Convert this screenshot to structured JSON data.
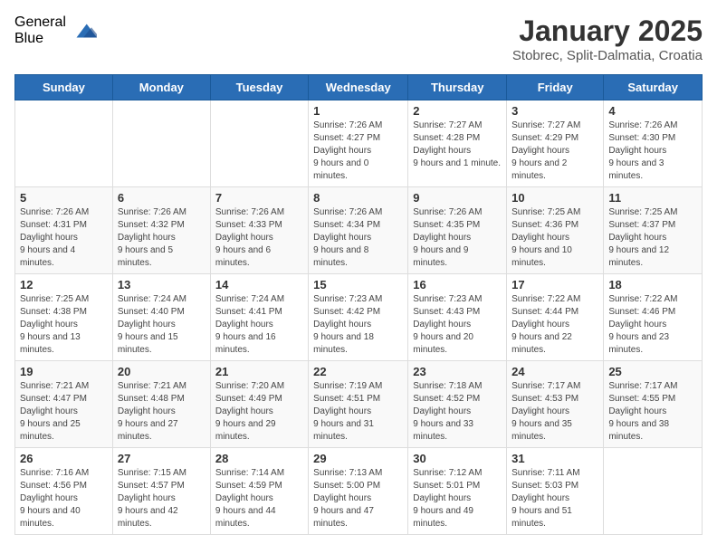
{
  "logo": {
    "general": "General",
    "blue": "Blue"
  },
  "header": {
    "title": "January 2025",
    "subtitle": "Stobrec, Split-Dalmatia, Croatia"
  },
  "weekdays": [
    "Sunday",
    "Monday",
    "Tuesday",
    "Wednesday",
    "Thursday",
    "Friday",
    "Saturday"
  ],
  "weeks": [
    [
      {
        "day": null
      },
      {
        "day": null
      },
      {
        "day": null
      },
      {
        "day": "1",
        "sunrise": "7:26 AM",
        "sunset": "4:27 PM",
        "daylight": "9 hours and 0 minutes."
      },
      {
        "day": "2",
        "sunrise": "7:27 AM",
        "sunset": "4:28 PM",
        "daylight": "9 hours and 1 minute."
      },
      {
        "day": "3",
        "sunrise": "7:27 AM",
        "sunset": "4:29 PM",
        "daylight": "9 hours and 2 minutes."
      },
      {
        "day": "4",
        "sunrise": "7:26 AM",
        "sunset": "4:30 PM",
        "daylight": "9 hours and 3 minutes."
      }
    ],
    [
      {
        "day": "5",
        "sunrise": "7:26 AM",
        "sunset": "4:31 PM",
        "daylight": "9 hours and 4 minutes."
      },
      {
        "day": "6",
        "sunrise": "7:26 AM",
        "sunset": "4:32 PM",
        "daylight": "9 hours and 5 minutes."
      },
      {
        "day": "7",
        "sunrise": "7:26 AM",
        "sunset": "4:33 PM",
        "daylight": "9 hours and 6 minutes."
      },
      {
        "day": "8",
        "sunrise": "7:26 AM",
        "sunset": "4:34 PM",
        "daylight": "9 hours and 8 minutes."
      },
      {
        "day": "9",
        "sunrise": "7:26 AM",
        "sunset": "4:35 PM",
        "daylight": "9 hours and 9 minutes."
      },
      {
        "day": "10",
        "sunrise": "7:25 AM",
        "sunset": "4:36 PM",
        "daylight": "9 hours and 10 minutes."
      },
      {
        "day": "11",
        "sunrise": "7:25 AM",
        "sunset": "4:37 PM",
        "daylight": "9 hours and 12 minutes."
      }
    ],
    [
      {
        "day": "12",
        "sunrise": "7:25 AM",
        "sunset": "4:38 PM",
        "daylight": "9 hours and 13 minutes."
      },
      {
        "day": "13",
        "sunrise": "7:24 AM",
        "sunset": "4:40 PM",
        "daylight": "9 hours and 15 minutes."
      },
      {
        "day": "14",
        "sunrise": "7:24 AM",
        "sunset": "4:41 PM",
        "daylight": "9 hours and 16 minutes."
      },
      {
        "day": "15",
        "sunrise": "7:23 AM",
        "sunset": "4:42 PM",
        "daylight": "9 hours and 18 minutes."
      },
      {
        "day": "16",
        "sunrise": "7:23 AM",
        "sunset": "4:43 PM",
        "daylight": "9 hours and 20 minutes."
      },
      {
        "day": "17",
        "sunrise": "7:22 AM",
        "sunset": "4:44 PM",
        "daylight": "9 hours and 22 minutes."
      },
      {
        "day": "18",
        "sunrise": "7:22 AM",
        "sunset": "4:46 PM",
        "daylight": "9 hours and 23 minutes."
      }
    ],
    [
      {
        "day": "19",
        "sunrise": "7:21 AM",
        "sunset": "4:47 PM",
        "daylight": "9 hours and 25 minutes."
      },
      {
        "day": "20",
        "sunrise": "7:21 AM",
        "sunset": "4:48 PM",
        "daylight": "9 hours and 27 minutes."
      },
      {
        "day": "21",
        "sunrise": "7:20 AM",
        "sunset": "4:49 PM",
        "daylight": "9 hours and 29 minutes."
      },
      {
        "day": "22",
        "sunrise": "7:19 AM",
        "sunset": "4:51 PM",
        "daylight": "9 hours and 31 minutes."
      },
      {
        "day": "23",
        "sunrise": "7:18 AM",
        "sunset": "4:52 PM",
        "daylight": "9 hours and 33 minutes."
      },
      {
        "day": "24",
        "sunrise": "7:17 AM",
        "sunset": "4:53 PM",
        "daylight": "9 hours and 35 minutes."
      },
      {
        "day": "25",
        "sunrise": "7:17 AM",
        "sunset": "4:55 PM",
        "daylight": "9 hours and 38 minutes."
      }
    ],
    [
      {
        "day": "26",
        "sunrise": "7:16 AM",
        "sunset": "4:56 PM",
        "daylight": "9 hours and 40 minutes."
      },
      {
        "day": "27",
        "sunrise": "7:15 AM",
        "sunset": "4:57 PM",
        "daylight": "9 hours and 42 minutes."
      },
      {
        "day": "28",
        "sunrise": "7:14 AM",
        "sunset": "4:59 PM",
        "daylight": "9 hours and 44 minutes."
      },
      {
        "day": "29",
        "sunrise": "7:13 AM",
        "sunset": "5:00 PM",
        "daylight": "9 hours and 47 minutes."
      },
      {
        "day": "30",
        "sunrise": "7:12 AM",
        "sunset": "5:01 PM",
        "daylight": "9 hours and 49 minutes."
      },
      {
        "day": "31",
        "sunrise": "7:11 AM",
        "sunset": "5:03 PM",
        "daylight": "9 hours and 51 minutes."
      },
      {
        "day": null
      }
    ]
  ],
  "labels": {
    "sunrise": "Sunrise:",
    "sunset": "Sunset:",
    "daylight": "Daylight hours"
  }
}
